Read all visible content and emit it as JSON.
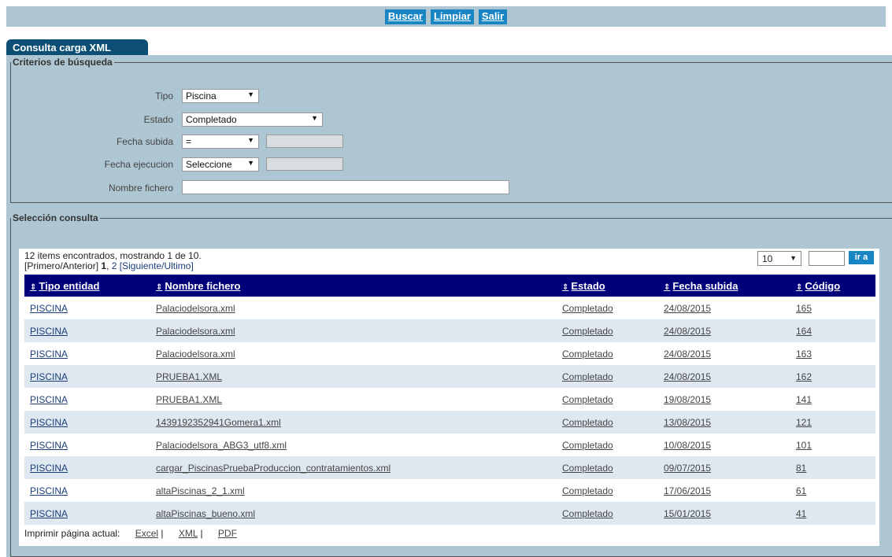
{
  "toolbar": {
    "buscar": "Buscar",
    "limpiar": "Limpiar",
    "salir": "Salir"
  },
  "tab": {
    "label": "Consulta carga XML"
  },
  "criteria": {
    "legend": "Criterios de búsqueda",
    "tipo_label": "Tipo",
    "tipo_value": "Piscina",
    "estado_label": "Estado",
    "estado_value": "Completado",
    "fecha_subida_label": "Fecha subida",
    "fecha_subida_op": "=",
    "fecha_ejecucion_label": "Fecha ejecucion",
    "fecha_ejecucion_op": "Seleccione",
    "nombre_fichero_label": "Nombre fichero",
    "nombre_fichero_value": ""
  },
  "selection": {
    "legend": "Selección consulta",
    "summary": "12 items encontrados, mostrando 1 de 10.",
    "pager_prefix": "[Primero/Anterior]",
    "pager_current": "1",
    "pager_page2": "2",
    "pager_next": "[Siguiente/Ultimo]",
    "page_size": "10",
    "goto_label": "ir a",
    "columns": [
      "Tipo entidad",
      "Nombre fichero",
      "Estado",
      "Fecha subida",
      "Código"
    ],
    "rows": [
      [
        "PISCINA",
        "Palaciodelsora.xml",
        "Completado",
        "24/08/2015",
        "165"
      ],
      [
        "PISCINA",
        "Palaciodelsora.xml",
        "Completado",
        "24/08/2015",
        "164"
      ],
      [
        "PISCINA",
        "Palaciodelsora.xml",
        "Completado",
        "24/08/2015",
        "163"
      ],
      [
        "PISCINA",
        "PRUEBA1.XML",
        "Completado",
        "24/08/2015",
        "162"
      ],
      [
        "PISCINA",
        "PRUEBA1.XML",
        "Completado",
        "19/08/2015",
        "141"
      ],
      [
        "PISCINA",
        "1439192352941Gomera1.xml",
        "Completado",
        "13/08/2015",
        "121"
      ],
      [
        "PISCINA",
        "Palaciodelsora_ABG3_utf8.xml",
        "Completado",
        "10/08/2015",
        "101"
      ],
      [
        "PISCINA",
        "cargar_PiscinasPruebaProduccion_contratamientos.xml",
        "Completado",
        "09/07/2015",
        "81"
      ],
      [
        "PISCINA",
        "altaPiscinas_2_1.xml",
        "Completado",
        "17/06/2015",
        "61"
      ],
      [
        "PISCINA",
        "altaPiscinas_bueno.xml",
        "Completado",
        "15/01/2015",
        "41"
      ]
    ],
    "print_label": "Imprimir página actual:",
    "export_excel": "Excel",
    "export_xml": "XML",
    "export_pdf": "PDF"
  }
}
